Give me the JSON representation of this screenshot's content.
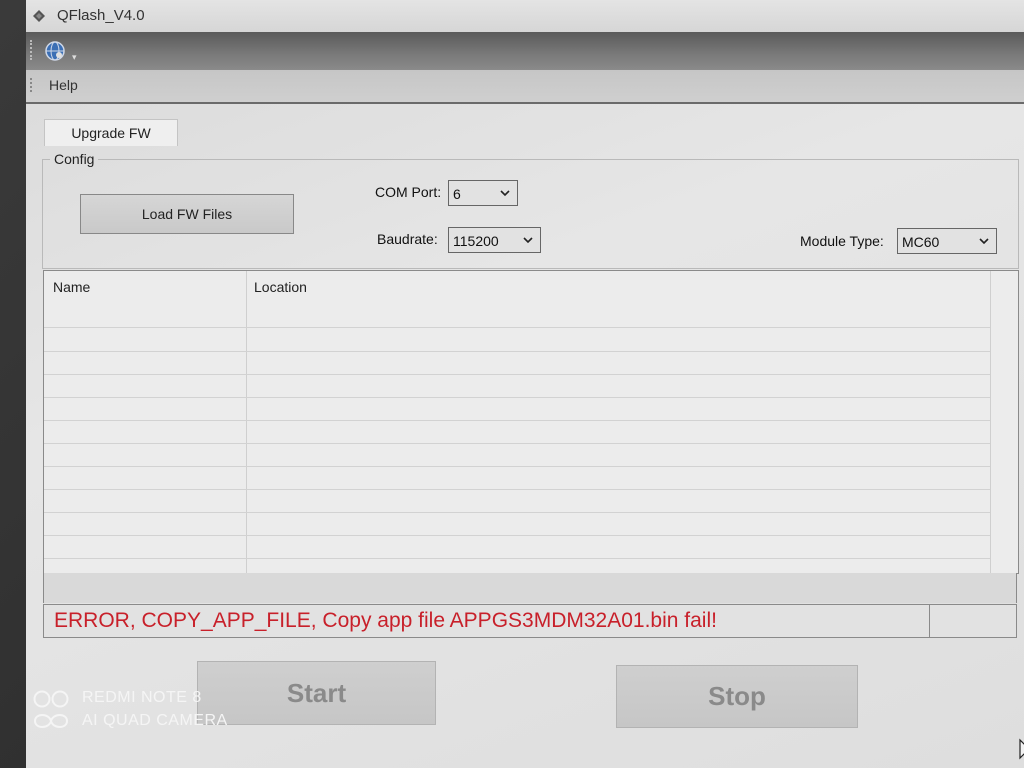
{
  "window": {
    "title": "QFlash_V4.0"
  },
  "menu": {
    "help": "Help"
  },
  "tabs": [
    {
      "label": "Upgrade FW",
      "selected": true
    }
  ],
  "config": {
    "group_label": "Config",
    "load_button": "Load FW Files",
    "com_port": {
      "label": "COM Port:",
      "value": "6"
    },
    "baudrate": {
      "label": "Baudrate:",
      "value": "115200"
    },
    "module_type": {
      "label": "Module Type:",
      "value": "MC60"
    }
  },
  "file_table": {
    "columns": [
      "Name",
      "Location"
    ],
    "rows": []
  },
  "status": {
    "message": "ERROR, COPY_APP_FILE, Copy app file APPGS3MDM32A01.bin fail!",
    "color": "#c8202a"
  },
  "actions": {
    "start": "Start",
    "stop": "Stop"
  },
  "camera_watermark": {
    "line1": "REDMI NOTE 8",
    "line2": "AI QUAD CAMERA"
  }
}
